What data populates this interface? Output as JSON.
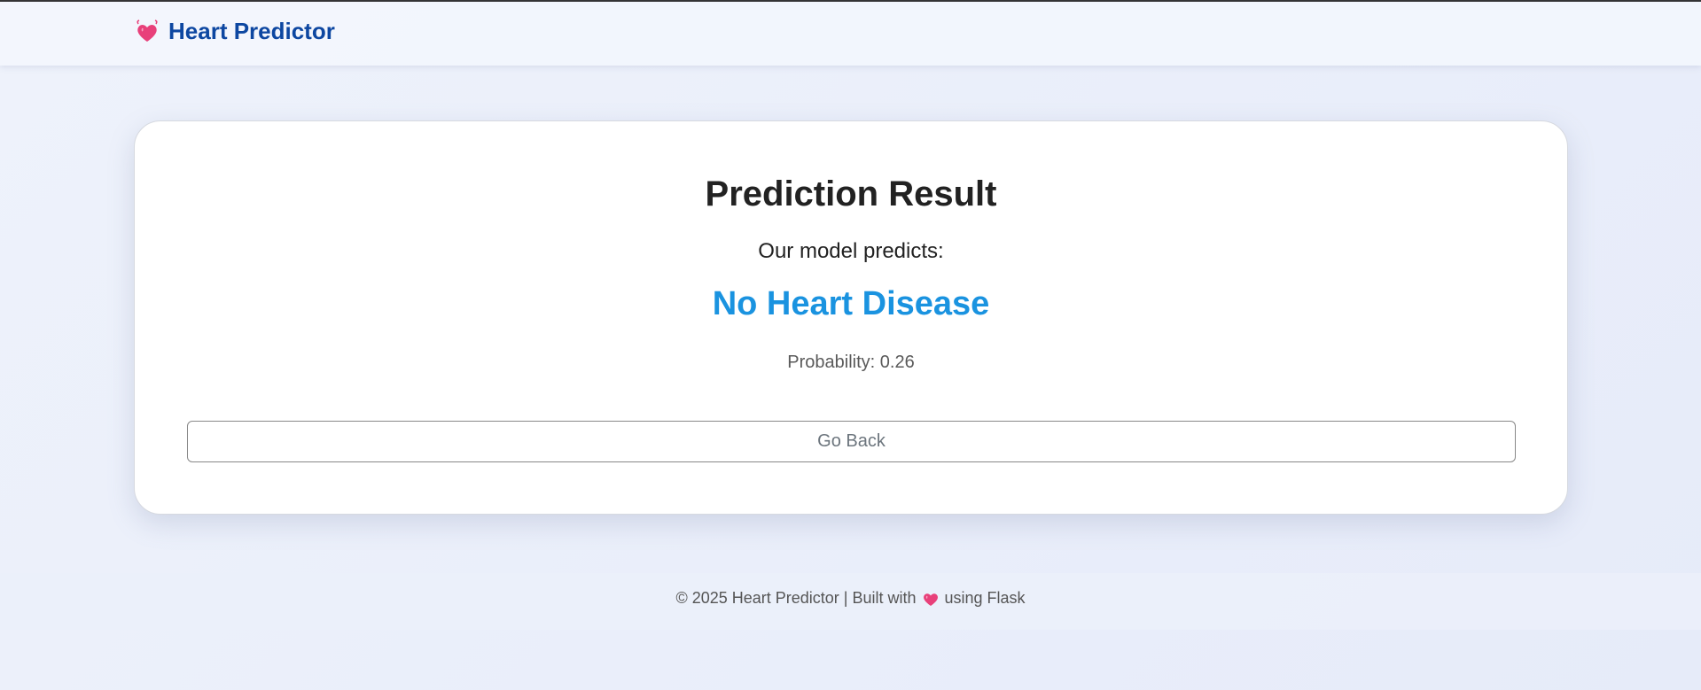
{
  "navbar": {
    "brand_icon": "heart-icon",
    "brand_text": "Heart Predictor"
  },
  "result_card": {
    "title": "Prediction Result",
    "subtitle": "Our model predicts:",
    "prediction": "No Heart Disease",
    "probability_label": "Probability:",
    "probability_value": "0.26",
    "back_button_label": "Go Back"
  },
  "footer": {
    "text_before": "© 2025 Heart Predictor | Built with",
    "icon": "heart-icon",
    "text_after": "using Flask"
  },
  "colors": {
    "brand": "#0d47a1",
    "prediction": "#1a93e0",
    "heart": "#e8407a"
  }
}
